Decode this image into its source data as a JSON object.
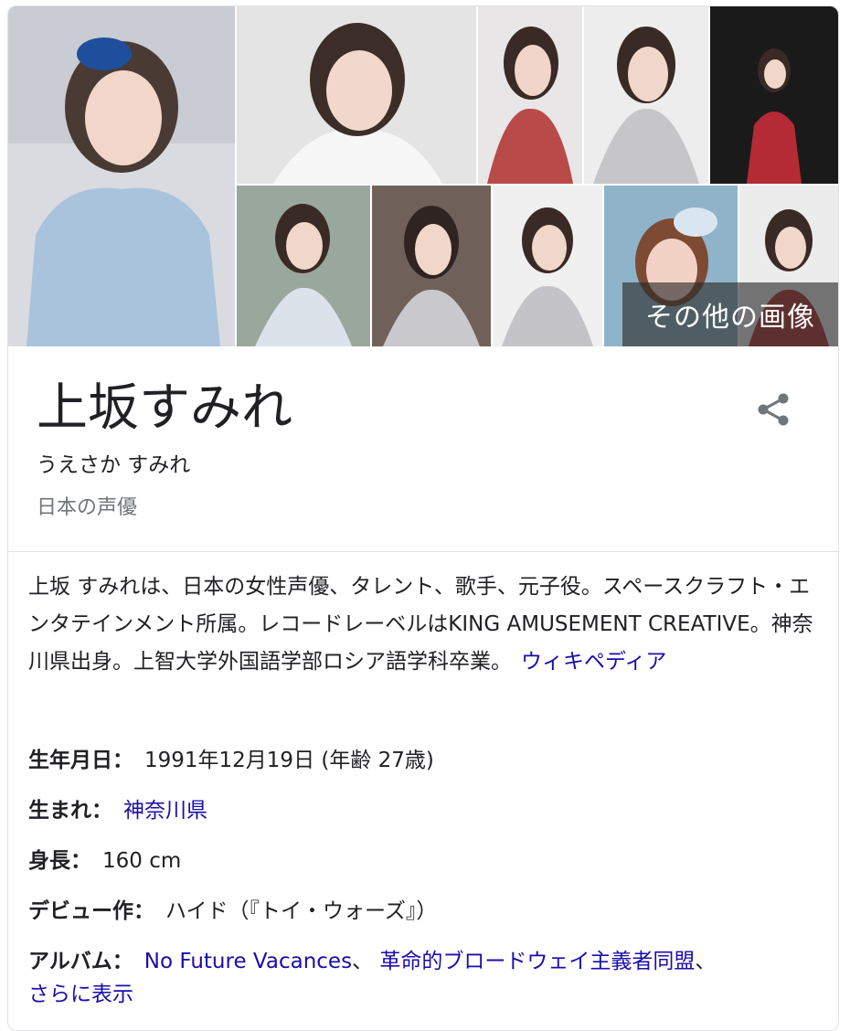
{
  "gallery": {
    "more_images_label": "その他の画像"
  },
  "entity": {
    "title": "上坂すみれ",
    "reading": "うえさか すみれ",
    "subtitle": "日本の声優",
    "share_icon": "share-icon"
  },
  "description": {
    "text": "上坂 すみれは、日本の女性声優、タレント、歌手、元子役。スペースクラフト・エンタテインメント所属。レコードレーベルはKING AMUSEMENT CREATIVE。神奈川県出身。上智大学外国語学部ロシア語学科卒業。",
    "source_link": "ウィキペディア"
  },
  "facts": {
    "birth_label": "生年月日：",
    "birth_value": "1991年12月19日 (年齢 27歳)",
    "born_label": "生まれ：",
    "born_link": "神奈川県",
    "height_label": "身長：",
    "height_value": "160 cm",
    "debut_label": "デビュー作：",
    "debut_value": "ハイド（『トイ・ウォーズ』）",
    "album_label": "アルバム：",
    "album_1": "No Future Vacances",
    "album_sep_1": "、",
    "album_2": "革命的ブロードウェイ主義者同盟",
    "album_sep_2": "、",
    "more_link": "さらに表示"
  },
  "colors": {
    "link": "#1a0dab",
    "muted": "#70757a",
    "border": "#dfe1e5"
  }
}
